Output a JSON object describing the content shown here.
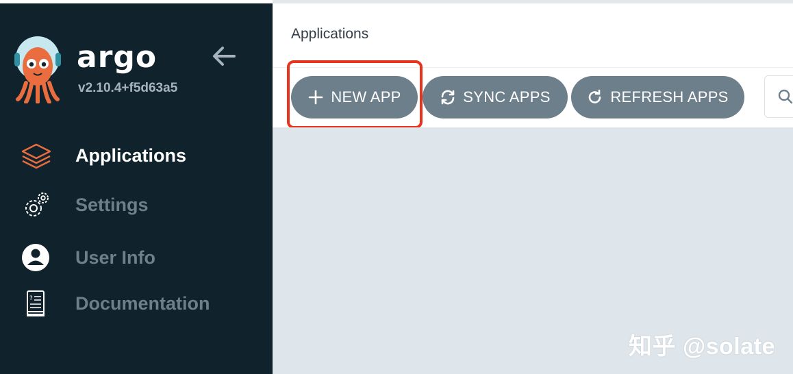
{
  "sidebar": {
    "brand": "argo",
    "version": "v2.10.4+f5d63a5",
    "items": [
      {
        "label": "Applications",
        "icon": "stack-layers-icon",
        "active": true
      },
      {
        "label": "Settings",
        "icon": "gears-icon",
        "active": false
      },
      {
        "label": "User Info",
        "icon": "user-circle-icon",
        "active": false
      },
      {
        "label": "Documentation",
        "icon": "book-icon",
        "active": false
      }
    ]
  },
  "header": {
    "title": "Applications"
  },
  "toolbar": {
    "new_app": "NEW APP",
    "sync_apps": "SYNC APPS",
    "refresh_apps": "REFRESH APPS"
  },
  "watermark": "知乎 @solate",
  "colors": {
    "sidebar_bg": "#10222b",
    "button_bg": "#6d7f8b",
    "accent_orange": "#e96d3e",
    "highlight_red": "#e8331f",
    "content_bg": "#dee6ec"
  }
}
